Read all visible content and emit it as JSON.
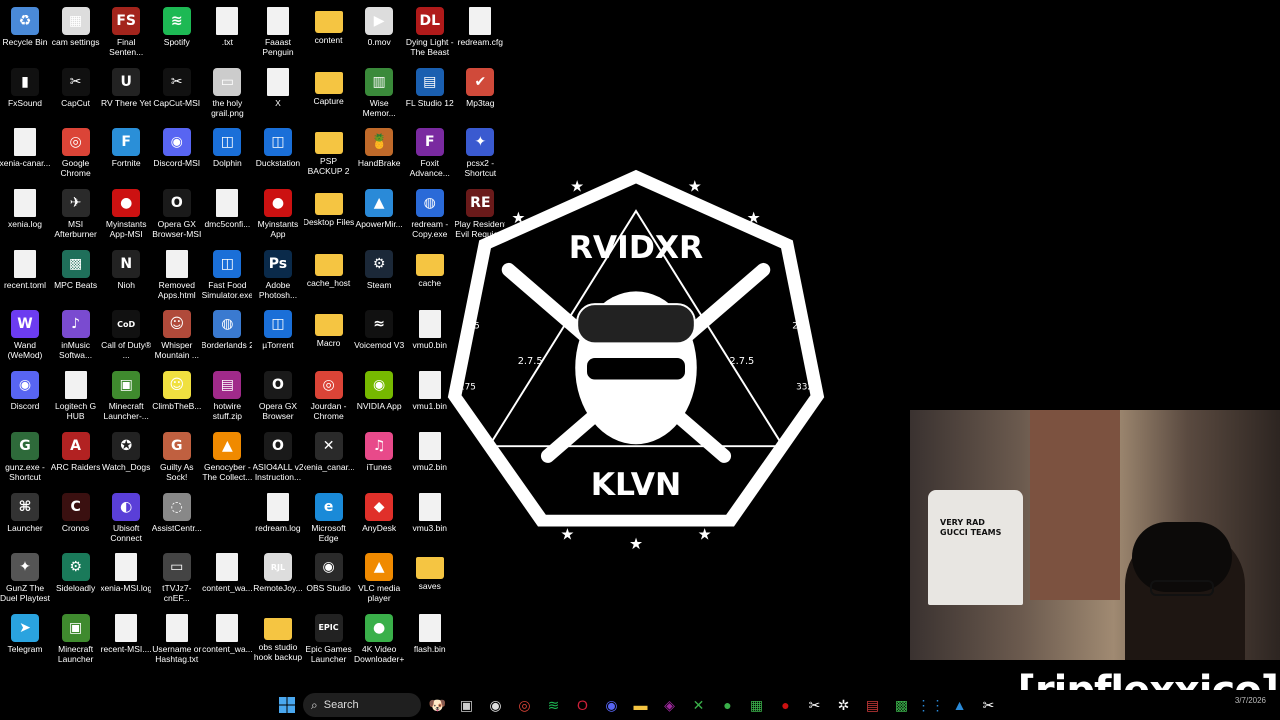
{
  "desktop_icons": [
    {
      "label": "Recycle Bin",
      "icon": "recycle-bin-icon",
      "color": "#4a8ad8",
      "glyph": "♻"
    },
    {
      "label": "FxSound",
      "icon": "fxsound-icon",
      "color": "#111111",
      "glyph": "▮"
    },
    {
      "label": "xenia-canar...",
      "icon": "file-icon",
      "kind": "file"
    },
    {
      "label": "xenia.log",
      "icon": "file-icon",
      "kind": "file"
    },
    {
      "label": "recent.toml",
      "icon": "file-icon",
      "kind": "file"
    },
    {
      "label": "Wand (WeMod)",
      "icon": "wand-icon",
      "color": "#6c3cf0",
      "glyph": "W"
    },
    {
      "label": "Discord",
      "icon": "discord-icon",
      "color": "#5865f2",
      "glyph": "◉"
    },
    {
      "label": "gunz.exe - Shortcut",
      "icon": "gunz-icon",
      "color": "#2e6a3a",
      "glyph": "G"
    },
    {
      "label": "Launcher",
      "icon": "launcher-icon",
      "color": "#333333",
      "glyph": "⌘"
    },
    {
      "label": "GunZ The Duel Playtest",
      "icon": "gunz-playtest-icon",
      "color": "#555555",
      "glyph": "✦"
    },
    {
      "label": "Telegram",
      "icon": "telegram-icon",
      "color": "#2aa3df",
      "glyph": "➤"
    },
    {
      "label": "cam settings",
      "icon": "cam-settings-icon",
      "color": "#dddddd",
      "glyph": "▦"
    },
    {
      "label": "CapCut",
      "icon": "capcut-icon",
      "color": "#111111",
      "glyph": "✂"
    },
    {
      "label": "Google Chrome",
      "icon": "chrome-icon",
      "color": "#db4437",
      "glyph": "◎"
    },
    {
      "label": "MSI Afterburner",
      "icon": "msi-afterburner-icon",
      "color": "#2a2a2a",
      "glyph": "✈"
    },
    {
      "label": "MPC Beats",
      "icon": "mpc-beats-icon",
      "color": "#1f6f5a",
      "glyph": "▩"
    },
    {
      "label": "inMusic Softwa...",
      "icon": "inmusic-icon",
      "color": "#7a4bd0",
      "glyph": "♪"
    },
    {
      "label": "Logitech G HUB",
      "icon": "file-icon",
      "kind": "file"
    },
    {
      "label": "ARC Raiders",
      "icon": "arc-raiders-icon",
      "color": "#b22222",
      "glyph": "A"
    },
    {
      "label": "Cronos",
      "icon": "cronos-icon",
      "color": "#3a1010",
      "glyph": "C"
    },
    {
      "label": "Sideloadly",
      "icon": "sideloadly-icon",
      "color": "#1a7a5a",
      "glyph": "⚙"
    },
    {
      "label": "Minecraft Launcher",
      "icon": "minecraft-icon",
      "color": "#3f8a2e",
      "glyph": "▣"
    },
    {
      "label": "Final Senten...",
      "icon": "final-sentence-icon",
      "color": "#a3241c",
      "glyph": "FS"
    },
    {
      "label": "RV There Yet",
      "icon": "unreal-icon",
      "color": "#222222",
      "glyph": "U"
    },
    {
      "label": "Fortnite",
      "icon": "fortnite-icon",
      "color": "#2a8fd8",
      "glyph": "F"
    },
    {
      "label": "Myinstants App-MSI",
      "icon": "myinstants-icon",
      "color": "#cc1111",
      "glyph": "●"
    },
    {
      "label": "Nioh",
      "icon": "nioh-icon",
      "color": "#222222",
      "glyph": "N"
    },
    {
      "label": "Call of Duty® ...",
      "icon": "cod-icon",
      "color": "#111111",
      "glyph": "CoD"
    },
    {
      "label": "Minecraft Launcher-...",
      "icon": "minecraft-icon",
      "color": "#3f8a2e",
      "glyph": "▣"
    },
    {
      "label": "Watch_Dogs",
      "icon": "watch-dogs-icon",
      "color": "#222222",
      "glyph": "✪"
    },
    {
      "label": "Ubisoft Connect",
      "icon": "ubisoft-icon",
      "color": "#5a3fd8",
      "glyph": "◐"
    },
    {
      "label": "xenia-MSI.log",
      "icon": "file-icon",
      "kind": "file"
    },
    {
      "label": "recent-MSI....",
      "icon": "file-icon",
      "kind": "file"
    },
    {
      "label": "Spotify",
      "icon": "spotify-icon",
      "color": "#1db954",
      "glyph": "≋"
    },
    {
      "label": "CapCut-MSI",
      "icon": "capcut-icon",
      "color": "#111111",
      "glyph": "✂"
    },
    {
      "label": "Discord-MSI",
      "icon": "discord-icon",
      "color": "#5865f2",
      "glyph": "◉"
    },
    {
      "label": "Opera GX Browser-MSI",
      "icon": "opera-gx-icon",
      "color": "#1a1a1a",
      "glyph": "O"
    },
    {
      "label": "Removed Apps.html",
      "icon": "file-icon",
      "kind": "file"
    },
    {
      "label": "Whisper Mountain ...",
      "icon": "whisper-mountain-icon",
      "color": "#b04a3a",
      "glyph": "☺"
    },
    {
      "label": "ClimbTheB...",
      "icon": "climb-icon",
      "color": "#f0e040",
      "glyph": "☺"
    },
    {
      "label": "Guilty As Sock!",
      "icon": "guilty-as-sock-icon",
      "color": "#c06040",
      "glyph": "G"
    },
    {
      "label": "AssistCentr...",
      "icon": "assist-centre-icon",
      "color": "#888888",
      "glyph": "◌"
    },
    {
      "label": "tTVJz7-cnEF...",
      "icon": "image-icon",
      "color": "#444444",
      "glyph": "▭"
    },
    {
      "label": "Username or Hashtag.txt",
      "icon": "file-icon",
      "kind": "file"
    },
    {
      "label": ".txt",
      "icon": "file-icon",
      "kind": "file"
    },
    {
      "label": "the holy grail.png",
      "icon": "image-icon",
      "color": "#cccccc",
      "glyph": "▭"
    },
    {
      "label": "Dolphin",
      "icon": "dolphin-icon",
      "color": "#1a6fd8",
      "glyph": "◫"
    },
    {
      "label": "dmc5confi...",
      "icon": "file-icon",
      "kind": "file"
    },
    {
      "label": "Fast Food Simulator.exe",
      "icon": "fast-food-icon",
      "color": "#1a6fd8",
      "glyph": "◫"
    },
    {
      "label": "Borderlands 2",
      "icon": "borderlands-icon",
      "color": "#3a7ad0",
      "glyph": "◍"
    },
    {
      "label": "hotwire stuff.zip",
      "icon": "zip-icon",
      "color": "#a02a8a",
      "glyph": "▤"
    },
    {
      "label": "Genocyber - The Collect...",
      "icon": "vlc-file-icon",
      "color": "#f08a00",
      "glyph": "▲"
    },
    {
      "label": "Genocyber - The Collect...",
      "icon": "hidden",
      "kind": "skip"
    },
    {
      "label": "content_wa...",
      "icon": "file-icon",
      "kind": "file"
    },
    {
      "label": "content_wa...",
      "icon": "file-icon",
      "kind": "file"
    },
    {
      "label": "Faaast Penguin",
      "icon": "file-icon",
      "kind": "file"
    },
    {
      "label": "X",
      "icon": "file-icon",
      "kind": "file"
    },
    {
      "label": "Duckstation",
      "icon": "duckstation-icon",
      "color": "#1a6fd8",
      "glyph": "◫"
    },
    {
      "label": "Myinstants App",
      "icon": "myinstants-icon",
      "color": "#cc1111",
      "glyph": "●"
    },
    {
      "label": "Adobe Photosh...",
      "icon": "photoshop-icon",
      "color": "#0a2a4a",
      "glyph": "Ps"
    },
    {
      "label": "µTorrent",
      "icon": "utorrent-icon",
      "color": "#1a6fd8",
      "glyph": "◫"
    },
    {
      "label": "Opera GX Browser",
      "icon": "opera-gx-icon",
      "color": "#1a1a1a",
      "glyph": "O"
    },
    {
      "label": "ASIO4ALL v2 Instruction...",
      "icon": "opera-icon",
      "color": "#1a1a1a",
      "glyph": "O"
    },
    {
      "label": "redream.log",
      "icon": "file-icon",
      "kind": "file"
    },
    {
      "label": "RemoteJoy...",
      "icon": "remotejoy-icon",
      "color": "#dddddd",
      "glyph": "RJL"
    },
    {
      "label": "obs studio hook backup",
      "icon": "folder-icon",
      "kind": "folder"
    },
    {
      "label": "content",
      "icon": "folder-icon",
      "kind": "folder"
    },
    {
      "label": "Capture",
      "icon": "folder-icon",
      "kind": "folder"
    },
    {
      "label": "PSP BACKUP 2",
      "icon": "folder-icon",
      "kind": "folder"
    },
    {
      "label": "Desktop Files",
      "icon": "folder-icon",
      "kind": "folder"
    },
    {
      "label": "cache_host",
      "icon": "folder-icon",
      "kind": "folder"
    },
    {
      "label": "Macro",
      "icon": "folder-icon",
      "kind": "folder"
    },
    {
      "label": "Jourdan - Chrome",
      "icon": "chrome-icon",
      "color": "#db4437",
      "glyph": "◎"
    },
    {
      "label": "xenia_canar...",
      "icon": "xenia-icon",
      "color": "#2a2a2a",
      "glyph": "✕"
    },
    {
      "label": "Microsoft Edge",
      "icon": "edge-icon",
      "color": "#1a8ad8",
      "glyph": "e"
    },
    {
      "label": "OBS Studio",
      "icon": "obs-icon",
      "color": "#2a2a2a",
      "glyph": "◉"
    },
    {
      "label": "Epic Games Launcher",
      "icon": "epic-icon",
      "color": "#222222",
      "glyph": "EPIC"
    },
    {
      "label": "0.mov",
      "icon": "video-file-icon",
      "color": "#dddddd",
      "glyph": "▶"
    },
    {
      "label": "Wise Memor...",
      "icon": "wise-memory-icon",
      "color": "#3a8a3a",
      "glyph": "▥"
    },
    {
      "label": "HandBrake",
      "icon": "handbrake-icon",
      "color": "#c06a2a",
      "glyph": "🍍"
    },
    {
      "label": "ApowerMir...",
      "icon": "apowermirror-icon",
      "color": "#2a8ad8",
      "glyph": "▲"
    },
    {
      "label": "Steam",
      "icon": "steam-icon",
      "color": "#1b2838",
      "glyph": "⚙"
    },
    {
      "label": "Voicemod V3",
      "icon": "voicemod-icon",
      "color": "#111111",
      "glyph": "≈"
    },
    {
      "label": "NVIDIA App",
      "icon": "nvidia-icon",
      "color": "#76b900",
      "glyph": "◉"
    },
    {
      "label": "iTunes",
      "icon": "itunes-icon",
      "color": "#e84a8a",
      "glyph": "♫"
    },
    {
      "label": "AnyDesk",
      "icon": "anydesk-icon",
      "color": "#e0302a",
      "glyph": "◆"
    },
    {
      "label": "VLC media player",
      "icon": "vlc-icon",
      "color": "#f08a00",
      "glyph": "▲"
    },
    {
      "label": "4K Video Downloader+",
      "icon": "4k-video-icon",
      "color": "#3ab04a",
      "glyph": "●"
    },
    {
      "label": "Dying Light - The Beast",
      "icon": "dying-light-icon",
      "color": "#b01a1a",
      "glyph": "DL"
    },
    {
      "label": "FL Studio 12",
      "icon": "fl-studio-icon",
      "color": "#1a5fb0",
      "glyph": "▤"
    },
    {
      "label": "Foxit Advance...",
      "icon": "foxit-icon",
      "color": "#7a2aa0",
      "glyph": "F"
    },
    {
      "label": "redream - Copy.exe",
      "icon": "redream-icon",
      "color": "#2a6ad8",
      "glyph": "◍"
    },
    {
      "label": "cache",
      "icon": "folder-icon",
      "kind": "folder"
    },
    {
      "label": "vmu0.bin",
      "icon": "file-icon",
      "kind": "file"
    },
    {
      "label": "vmu1.bin",
      "icon": "file-icon",
      "kind": "file"
    },
    {
      "label": "vmu2.bin",
      "icon": "file-icon",
      "kind": "file"
    },
    {
      "label": "vmu3.bin",
      "icon": "file-icon",
      "kind": "file"
    },
    {
      "label": "saves",
      "icon": "folder-icon",
      "kind": "folder"
    },
    {
      "label": "flash.bin",
      "icon": "file-icon",
      "kind": "file"
    },
    {
      "label": "redream.cfg",
      "icon": "file-icon",
      "kind": "file"
    },
    {
      "label": "Mp3tag",
      "icon": "mp3tag-icon",
      "color": "#d04a3a",
      "glyph": "✔"
    },
    {
      "label": "pcsx2 - Shortcut",
      "icon": "pcsx2-icon",
      "color": "#3a5ad0",
      "glyph": "✦"
    },
    {
      "label": "Play Resident Evil Requiem",
      "icon": "resident-evil-icon",
      "color": "#6a1a1a",
      "glyph": "RE"
    },
    {
      "label": "",
      "icon": "empty",
      "kind": "skip"
    },
    {
      "label": "",
      "icon": "empty",
      "kind": "skip"
    },
    {
      "label": "",
      "icon": "empty",
      "kind": "skip"
    },
    {
      "label": "",
      "icon": "empty",
      "kind": "skip"
    },
    {
      "label": "",
      "icon": "empty",
      "kind": "skip"
    },
    {
      "label": "",
      "icon": "empty",
      "kind": "skip"
    },
    {
      "label": "",
      "icon": "empty",
      "kind": "skip"
    },
    {
      "label": "",
      "icon": "empty",
      "kind": "skip"
    }
  ],
  "wallpaper": {
    "top_text": "RVIDXR",
    "bottom_text": "KLVN",
    "left_small": "2.7.5",
    "right_small": "2.7.5",
    "left_edge": "275",
    "right_edge": "275",
    "left_edge2": "275",
    "right_edge2": "332"
  },
  "webcam": {
    "shirt_text": "VERY RAD GUCCI TEAMS"
  },
  "streamer_name": "[ripflexxico]",
  "taskbar": {
    "search_placeholder": "Search",
    "apps": [
      {
        "name": "widgets-icon",
        "glyph": "🐶",
        "color": "#c89a6a"
      },
      {
        "name": "task-view-icon",
        "glyph": "▣",
        "color": "#cccccc"
      },
      {
        "name": "obs-taskbar-icon",
        "glyph": "◉",
        "color": "#dddddd"
      },
      {
        "name": "chrome-taskbar-icon",
        "glyph": "◎",
        "color": "#db4437"
      },
      {
        "name": "spotify-taskbar-icon",
        "glyph": "≋",
        "color": "#1db954"
      },
      {
        "name": "opera-taskbar-icon",
        "glyph": "O",
        "color": "#d0203a"
      },
      {
        "name": "discord-taskbar-icon",
        "glyph": "◉",
        "color": "#5865f2"
      },
      {
        "name": "file-explorer-icon",
        "glyph": "▬",
        "color": "#f5c542"
      },
      {
        "name": "app-taskbar-icon",
        "glyph": "◈",
        "color": "#a02aa0"
      },
      {
        "name": "xbox-icon",
        "glyph": "✕",
        "color": "#3ab04a"
      },
      {
        "name": "green-app-icon",
        "glyph": "●",
        "color": "#3ab04a"
      },
      {
        "name": "game-app-icon",
        "glyph": "▦",
        "color": "#3ab04a"
      },
      {
        "name": "red-app-icon",
        "glyph": "●",
        "color": "#cc1111"
      },
      {
        "name": "capcut-taskbar-icon",
        "glyph": "✂",
        "color": "#ffffff"
      },
      {
        "name": "chatgpt-icon",
        "glyph": "✲",
        "color": "#ffffff"
      },
      {
        "name": "photo-app-icon",
        "glyph": "▤",
        "color": "#cc3a3a"
      },
      {
        "name": "green-tool-icon",
        "glyph": "▩",
        "color": "#3ab04a"
      },
      {
        "name": "grid-app-icon",
        "glyph": "⋮⋮",
        "color": "#2a8ad8"
      },
      {
        "name": "blue-app-icon",
        "glyph": "▲",
        "color": "#2a8ad8"
      },
      {
        "name": "capcut2-taskbar-icon",
        "glyph": "✂",
        "color": "#ffffff"
      }
    ],
    "clock": "3/7/2026"
  },
  "colors": {
    "background": "#000000",
    "folder": "#f5c542"
  }
}
